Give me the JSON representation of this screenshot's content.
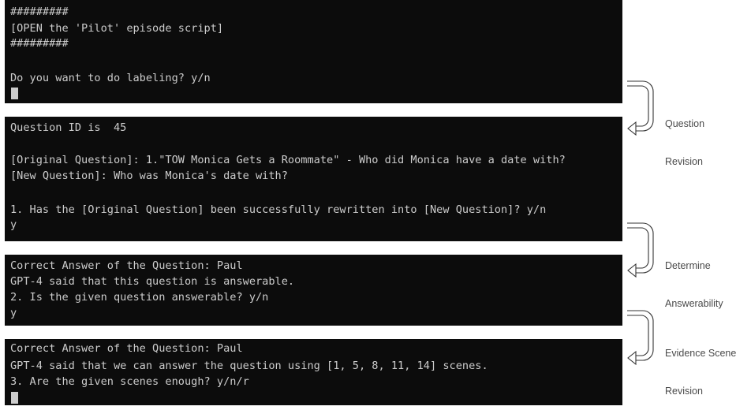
{
  "panels": [
    {
      "lines": [
        "#########",
        "[OPEN the 'Pilot' episode script]",
        "#########",
        "",
        "Do you want to do labeling? y/n"
      ]
    },
    {
      "lines": [
        "Question ID is  45",
        "",
        "[Original Question]: 1.\"TOW Monica Gets a Roommate\" - Who did Monica have a date with?",
        "[New Question]: Who was Monica's date with?",
        "",
        "1. Has the [Original Question] been successfully rewritten into [New Question]? y/n",
        "y"
      ]
    },
    {
      "lines": [
        "Correct Answer of the Question: Paul",
        "GPT-4 said that this question is answerable.",
        "2. Is the given question answerable? y/n",
        "y"
      ]
    },
    {
      "lines": [
        "Correct Answer of the Question: Paul",
        "GPT-4 said that we can answer the question using [1, 5, 8, 11, 14] scenes.",
        "3. Are the given scenes enough? y/n/r"
      ]
    }
  ],
  "annotations": [
    {
      "line1": "Question",
      "line2": "Revision"
    },
    {
      "line1": "Determine",
      "line2": "Answerability"
    },
    {
      "line1": "Evidence Scene",
      "line2": "Revision"
    }
  ]
}
